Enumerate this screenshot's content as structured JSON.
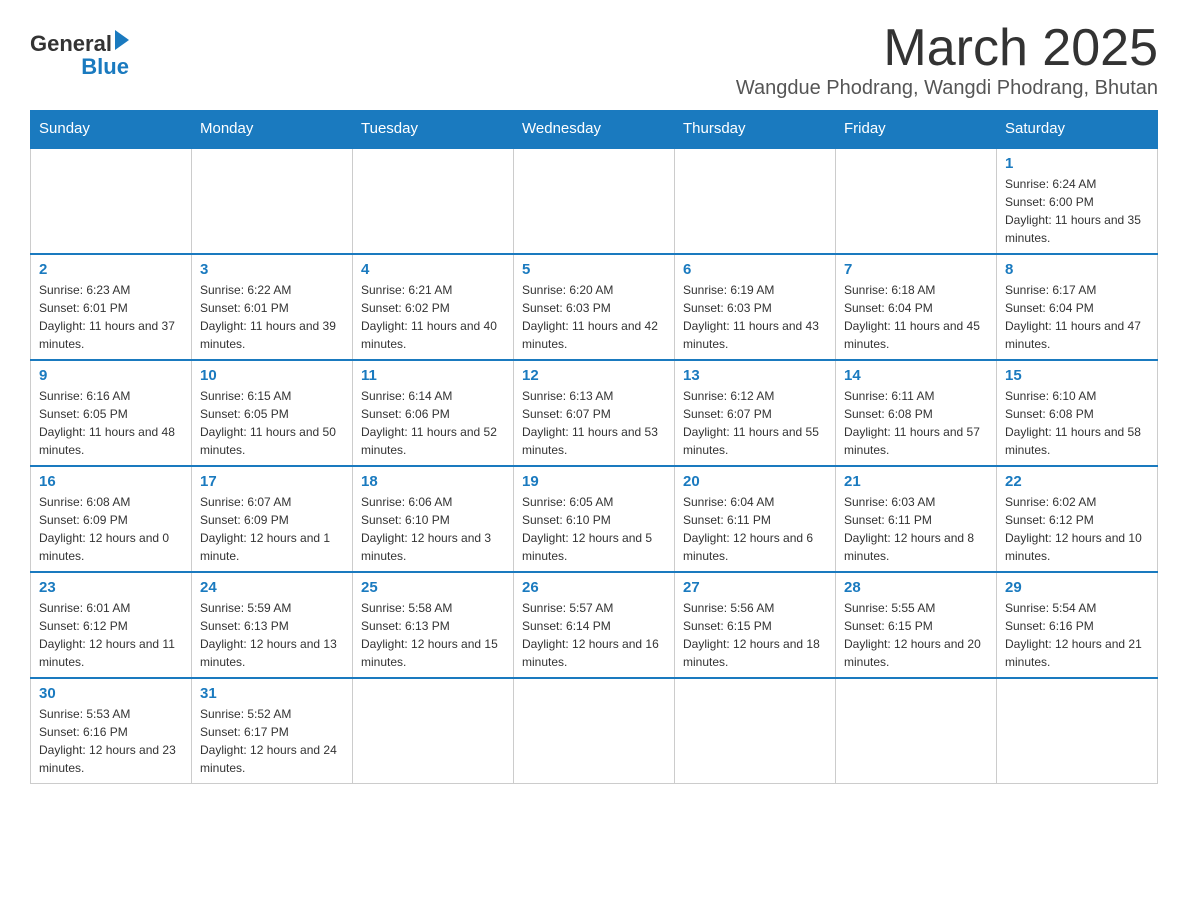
{
  "header": {
    "logo_text_general": "General",
    "logo_text_blue": "Blue",
    "month_title": "March 2025",
    "location": "Wangdue Phodrang, Wangdi Phodrang, Bhutan"
  },
  "days_of_week": [
    "Sunday",
    "Monday",
    "Tuesday",
    "Wednesday",
    "Thursday",
    "Friday",
    "Saturday"
  ],
  "weeks": [
    [
      {
        "day": null
      },
      {
        "day": null
      },
      {
        "day": null
      },
      {
        "day": null
      },
      {
        "day": null
      },
      {
        "day": null
      },
      {
        "day": 1,
        "sunrise": "6:24 AM",
        "sunset": "6:00 PM",
        "daylight": "11 hours and 35 minutes."
      }
    ],
    [
      {
        "day": 2,
        "sunrise": "6:23 AM",
        "sunset": "6:01 PM",
        "daylight": "11 hours and 37 minutes."
      },
      {
        "day": 3,
        "sunrise": "6:22 AM",
        "sunset": "6:01 PM",
        "daylight": "11 hours and 39 minutes."
      },
      {
        "day": 4,
        "sunrise": "6:21 AM",
        "sunset": "6:02 PM",
        "daylight": "11 hours and 40 minutes."
      },
      {
        "day": 5,
        "sunrise": "6:20 AM",
        "sunset": "6:03 PM",
        "daylight": "11 hours and 42 minutes."
      },
      {
        "day": 6,
        "sunrise": "6:19 AM",
        "sunset": "6:03 PM",
        "daylight": "11 hours and 43 minutes."
      },
      {
        "day": 7,
        "sunrise": "6:18 AM",
        "sunset": "6:04 PM",
        "daylight": "11 hours and 45 minutes."
      },
      {
        "day": 8,
        "sunrise": "6:17 AM",
        "sunset": "6:04 PM",
        "daylight": "11 hours and 47 minutes."
      }
    ],
    [
      {
        "day": 9,
        "sunrise": "6:16 AM",
        "sunset": "6:05 PM",
        "daylight": "11 hours and 48 minutes."
      },
      {
        "day": 10,
        "sunrise": "6:15 AM",
        "sunset": "6:05 PM",
        "daylight": "11 hours and 50 minutes."
      },
      {
        "day": 11,
        "sunrise": "6:14 AM",
        "sunset": "6:06 PM",
        "daylight": "11 hours and 52 minutes."
      },
      {
        "day": 12,
        "sunrise": "6:13 AM",
        "sunset": "6:07 PM",
        "daylight": "11 hours and 53 minutes."
      },
      {
        "day": 13,
        "sunrise": "6:12 AM",
        "sunset": "6:07 PM",
        "daylight": "11 hours and 55 minutes."
      },
      {
        "day": 14,
        "sunrise": "6:11 AM",
        "sunset": "6:08 PM",
        "daylight": "11 hours and 57 minutes."
      },
      {
        "day": 15,
        "sunrise": "6:10 AM",
        "sunset": "6:08 PM",
        "daylight": "11 hours and 58 minutes."
      }
    ],
    [
      {
        "day": 16,
        "sunrise": "6:08 AM",
        "sunset": "6:09 PM",
        "daylight": "12 hours and 0 minutes."
      },
      {
        "day": 17,
        "sunrise": "6:07 AM",
        "sunset": "6:09 PM",
        "daylight": "12 hours and 1 minute."
      },
      {
        "day": 18,
        "sunrise": "6:06 AM",
        "sunset": "6:10 PM",
        "daylight": "12 hours and 3 minutes."
      },
      {
        "day": 19,
        "sunrise": "6:05 AM",
        "sunset": "6:10 PM",
        "daylight": "12 hours and 5 minutes."
      },
      {
        "day": 20,
        "sunrise": "6:04 AM",
        "sunset": "6:11 PM",
        "daylight": "12 hours and 6 minutes."
      },
      {
        "day": 21,
        "sunrise": "6:03 AM",
        "sunset": "6:11 PM",
        "daylight": "12 hours and 8 minutes."
      },
      {
        "day": 22,
        "sunrise": "6:02 AM",
        "sunset": "6:12 PM",
        "daylight": "12 hours and 10 minutes."
      }
    ],
    [
      {
        "day": 23,
        "sunrise": "6:01 AM",
        "sunset": "6:12 PM",
        "daylight": "12 hours and 11 minutes."
      },
      {
        "day": 24,
        "sunrise": "5:59 AM",
        "sunset": "6:13 PM",
        "daylight": "12 hours and 13 minutes."
      },
      {
        "day": 25,
        "sunrise": "5:58 AM",
        "sunset": "6:13 PM",
        "daylight": "12 hours and 15 minutes."
      },
      {
        "day": 26,
        "sunrise": "5:57 AM",
        "sunset": "6:14 PM",
        "daylight": "12 hours and 16 minutes."
      },
      {
        "day": 27,
        "sunrise": "5:56 AM",
        "sunset": "6:15 PM",
        "daylight": "12 hours and 18 minutes."
      },
      {
        "day": 28,
        "sunrise": "5:55 AM",
        "sunset": "6:15 PM",
        "daylight": "12 hours and 20 minutes."
      },
      {
        "day": 29,
        "sunrise": "5:54 AM",
        "sunset": "6:16 PM",
        "daylight": "12 hours and 21 minutes."
      }
    ],
    [
      {
        "day": 30,
        "sunrise": "5:53 AM",
        "sunset": "6:16 PM",
        "daylight": "12 hours and 23 minutes."
      },
      {
        "day": 31,
        "sunrise": "5:52 AM",
        "sunset": "6:17 PM",
        "daylight": "12 hours and 24 minutes."
      },
      {
        "day": null
      },
      {
        "day": null
      },
      {
        "day": null
      },
      {
        "day": null
      },
      {
        "day": null
      }
    ]
  ]
}
